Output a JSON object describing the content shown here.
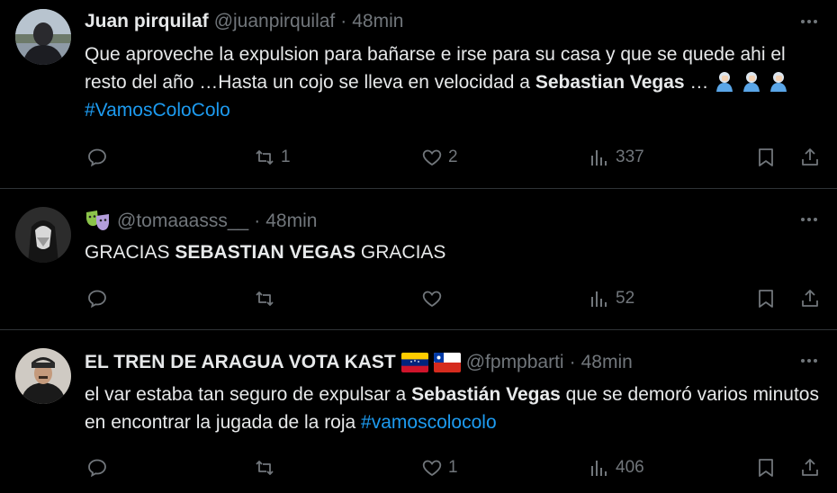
{
  "tweets": [
    {
      "name": "Juan pirquilaf",
      "handle": "@juanpirquilaf",
      "sep": "·",
      "time": "48min",
      "text": [
        {
          "t": "Que aproveche la expulsion para bañarse  e irse para su casa y que se quede ahi el resto del año …Hasta un cojo se lleva en velocidad a ",
          "style": "plain"
        },
        {
          "t": "Sebastian Vegas",
          "style": "bold"
        },
        {
          "t": " … ",
          "style": "plain"
        },
        {
          "t": "#VamosColoColo",
          "style": "hashtag"
        }
      ],
      "emoji_icon": "person-facepalming-emoji",
      "stats": {
        "replies": "",
        "reposts": "1",
        "likes": "2",
        "views": "337"
      }
    },
    {
      "name": "",
      "name_icon": "performing-arts-emoji",
      "handle": "@tomaaasss__",
      "sep": "·",
      "time": "48min",
      "text": [
        {
          "t": "GRACIAS ",
          "style": "plain"
        },
        {
          "t": "SEBASTIAN VEGAS",
          "style": "bold"
        },
        {
          "t": " GRACIAS",
          "style": "plain"
        }
      ],
      "stats": {
        "replies": "",
        "reposts": "",
        "likes": "",
        "views": "52"
      }
    },
    {
      "name": "EL TREN DE ARAGUA VOTA KAST",
      "name_flags": [
        "venezuela-flag",
        "chile-flag"
      ],
      "handle": "@fpmpbarti",
      "sep": "·",
      "time": "48min",
      "text": [
        {
          "t": "el var estaba tan seguro de expulsar a ",
          "style": "plain"
        },
        {
          "t": "Sebastián Vegas",
          "style": "bold"
        },
        {
          "t": " que se demoró varios minutos en encontrar la jugada de la roja ",
          "style": "plain"
        },
        {
          "t": "#vamoscolocolo",
          "style": "hashtag"
        }
      ],
      "stats": {
        "replies": "",
        "reposts": "",
        "likes": "1",
        "views": "406"
      }
    }
  ],
  "colors": {
    "background": "#000000",
    "text": "#e7e9ea",
    "muted": "#71767b",
    "link": "#1d9bf0",
    "divider": "#2f3336"
  }
}
